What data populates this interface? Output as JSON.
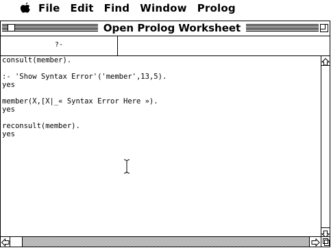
{
  "menubar": {
    "apple_icon": "apple-logo-icon",
    "items": [
      {
        "label": "File"
      },
      {
        "label": "Edit"
      },
      {
        "label": "Find"
      },
      {
        "label": "Window"
      },
      {
        "label": "Prolog"
      }
    ]
  },
  "window": {
    "title": "Open Prolog Worksheet",
    "query_prompt": "?-",
    "query_value": ""
  },
  "worksheet": {
    "lines": [
      "consult(member).",
      "",
      ":- 'Show Syntax Error'('member',13,5).",
      "yes",
      "",
      "member(X,[X|_« Syntax Error Here »).",
      "yes",
      "",
      "reconsult(member).",
      "yes"
    ]
  },
  "icons": {
    "close": "close-box-icon",
    "zoom": "zoom-box-icon",
    "scroll_up": "scroll-up-arrow-icon",
    "scroll_down": "scroll-down-arrow-icon",
    "scroll_left": "scroll-left-arrow-icon",
    "scroll_right": "scroll-right-arrow-icon",
    "grow": "grow-box-icon",
    "cursor": "text-cursor-icon"
  }
}
